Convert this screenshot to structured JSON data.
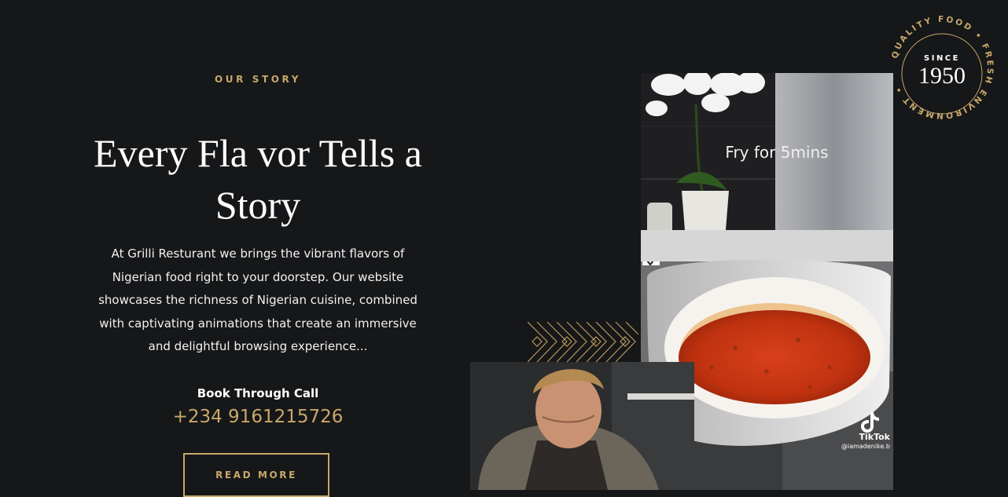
{
  "story": {
    "eyebrow": "OUR STORY",
    "heading": "Every Fla vor Tells a Story",
    "description": "At Grilli Resturant we brings the vibrant flavors of Nigerian food right to your doorstep. Our website showcases the richness of Nigerian cuisine, combined with captivating animations that create an immersive and delightful browsing experience...",
    "book_label": "Book Through Call",
    "phone": "+234 9161215726",
    "cta_label": "READ MORE"
  },
  "food_photo": {
    "caption": "Fry for 5mins",
    "watermark_brand": "TikTok",
    "watermark_handle": "@iamadenike.b",
    "icon": "tiktok-icon"
  },
  "chef_photo": {
    "icon": "chef-photo"
  },
  "seal": {
    "ring_text": "QUALITY FOOD • FRESH ENVIRONMENT •",
    "since_label": "SINCE",
    "year": "1950"
  },
  "colors": {
    "background": "#161719",
    "accent_gold": "#c8a86a",
    "text": "#ffffff"
  }
}
